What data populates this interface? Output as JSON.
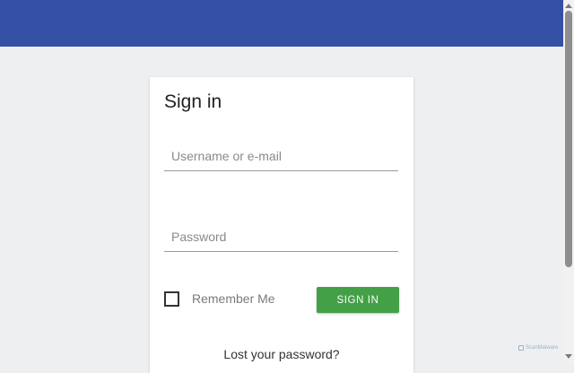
{
  "header": {
    "color": "#3451a5"
  },
  "login": {
    "title": "Sign in",
    "username_placeholder": "Username or e-mail",
    "username_value": "",
    "password_placeholder": "Password",
    "password_value": "",
    "remember_label": "Remember Me",
    "remember_checked": false,
    "signin_label": "SIGN IN",
    "signin_color": "#43a047",
    "lost_password": "Lost your password?"
  },
  "watermark": {
    "text": "ScanMalware",
    "icon": "scanmalware-logo-icon"
  }
}
